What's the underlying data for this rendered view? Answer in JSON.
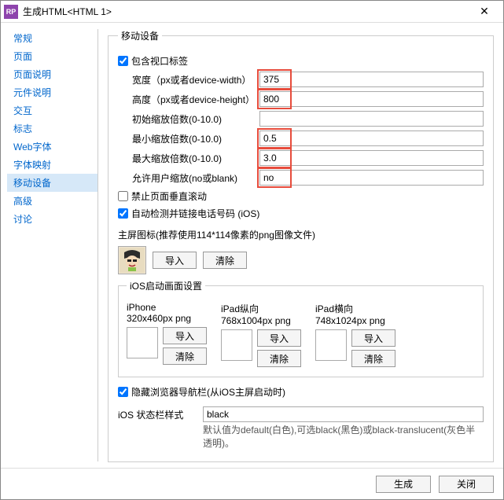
{
  "window": {
    "app_icon_text": "RP",
    "title": "生成HTML<HTML 1>"
  },
  "sidebar": {
    "items": [
      {
        "label": "常规"
      },
      {
        "label": "页面"
      },
      {
        "label": "页面说明"
      },
      {
        "label": "元件说明"
      },
      {
        "label": "交互"
      },
      {
        "label": "标志"
      },
      {
        "label": "Web字体"
      },
      {
        "label": "字体映射"
      },
      {
        "label": "移动设备"
      },
      {
        "label": "高级"
      },
      {
        "label": "讨论"
      }
    ],
    "selected_index": 8
  },
  "mobile": {
    "legend": "移动设备",
    "include_viewport_label": "包含视口标签",
    "include_viewport_checked": true,
    "fields": {
      "width_label": "宽度（px或者device-width）",
      "width_value": "375",
      "height_label": "高度（px或者device-height）",
      "height_value": "800",
      "initial_scale_label": "初始缩放倍数(0-10.0)",
      "initial_scale_value": "",
      "min_scale_label": "最小缩放倍数(0-10.0)",
      "min_scale_value": "0.5",
      "max_scale_label": "最大缩放倍数(0-10.0)",
      "max_scale_value": "3.0",
      "user_scalable_label": "允许用户缩放(no或blank)",
      "user_scalable_value": "no"
    },
    "disable_vscroll_label": "禁止页面垂直滚动",
    "disable_vscroll_checked": false,
    "auto_detect_phone_label": "自动检测并链接电话号码 (iOS)",
    "auto_detect_phone_checked": true,
    "home_icon_label": "主屏图标(推荐使用114*114像素的png图像文件)",
    "import_label": "导入",
    "clear_label": "清除",
    "launch": {
      "legend": "iOS启动画面设置",
      "cols": [
        {
          "title": "iPhone",
          "sub": "320x460px png"
        },
        {
          "title": "iPad纵向",
          "sub": "768x1004px png"
        },
        {
          "title": "iPad横向",
          "sub": "748x1024px png"
        }
      ]
    },
    "hide_navbar_label": "隐藏浏览器导航栏(从iOS主屏启动时)",
    "hide_navbar_checked": true,
    "statusbar_label": "iOS 状态栏样式",
    "statusbar_value": "black",
    "statusbar_hint": "默认值为default(白色),可选black(黑色)或black-translucent(灰色半透明)。"
  },
  "footer": {
    "generate": "生成",
    "close": "关闭"
  }
}
